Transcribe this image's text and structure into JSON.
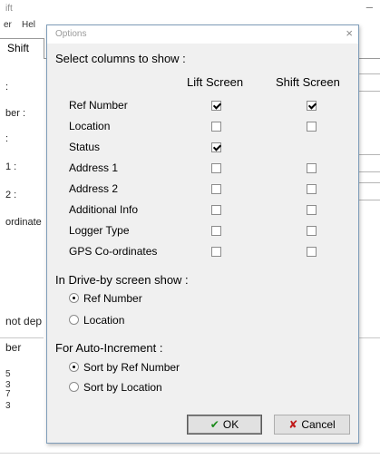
{
  "background": {
    "title_fragment": "ift",
    "menu_fragments": [
      "er",
      "Hel"
    ],
    "tab_label": "Shift",
    "labels": [
      ":",
      "ber :",
      ":",
      "1 :",
      "2 :",
      "ordinate",
      "not dep",
      "ber"
    ],
    "rows": [
      "5",
      "3",
      "7",
      "3"
    ]
  },
  "dialog": {
    "title": "Options",
    "close_glyph": "×",
    "columns_heading": "Select columns to show :",
    "col_lift": "Lift Screen",
    "col_shift": "Shift Screen",
    "rows": [
      {
        "label": "Ref Number",
        "lift": true,
        "shift": true
      },
      {
        "label": "Location",
        "lift": false,
        "shift": false
      },
      {
        "label": "Status",
        "lift": true,
        "shift": null
      },
      {
        "label": "Address 1",
        "lift": false,
        "shift": false
      },
      {
        "label": "Address 2",
        "lift": false,
        "shift": false
      },
      {
        "label": "Additional Info",
        "lift": false,
        "shift": false
      },
      {
        "label": "Logger Type",
        "lift": false,
        "shift": false
      },
      {
        "label": "GPS Co-ordinates",
        "lift": false,
        "shift": false
      }
    ],
    "driveby_heading": "In Drive-by screen show :",
    "driveby_options": [
      {
        "label": "Ref Number",
        "selected": true
      },
      {
        "label": "Location",
        "selected": false
      }
    ],
    "autoinc_heading": "For Auto-Increment :",
    "autoinc_options": [
      {
        "label": "Sort by Ref Number",
        "selected": true
      },
      {
        "label": "Sort by Location",
        "selected": false
      }
    ],
    "ok_label": "OK",
    "cancel_label": "Cancel",
    "ok_icon": "checkmark-icon",
    "cancel_icon": "x-icon",
    "colors": {
      "ok_icon": "#1a8a1a",
      "cancel_icon": "#c01818",
      "border": "#7f9db9",
      "face": "#f0f0f0"
    }
  }
}
